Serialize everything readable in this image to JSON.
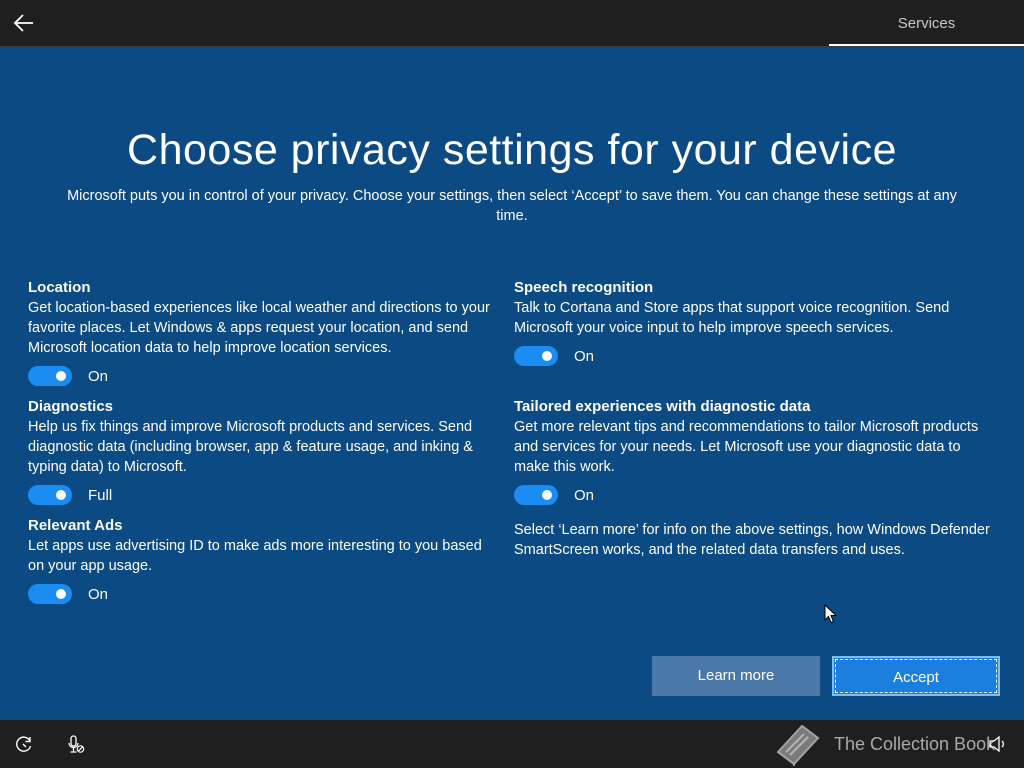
{
  "header": {
    "tab_label": "Services"
  },
  "page": {
    "title": "Choose privacy settings for your device",
    "description": "Microsoft puts you in control of your privacy. Choose your settings, then select ‘Accept’ to save them. You can change these settings at any time."
  },
  "settings": {
    "location": {
      "title": "Location",
      "description": "Get location-based experiences like local weather and directions to your favorite places. Let Windows & apps request your location, and send Microsoft location data to help improve location services.",
      "state": "On"
    },
    "diagnostics": {
      "title": "Diagnostics",
      "description": "Help us fix things and improve Microsoft products and services. Send diagnostic data (including browser, app & feature usage, and inking & typing data) to Microsoft.",
      "state": "Full"
    },
    "relevant_ads": {
      "title": "Relevant Ads",
      "description": "Let apps use advertising ID to make ads more interesting to you based on your app usage.",
      "state": "On"
    },
    "speech": {
      "title": "Speech recognition",
      "description": "Talk to Cortana and Store apps that support voice recognition. Send Microsoft your voice input to help improve speech services.",
      "state": "On"
    },
    "tailored": {
      "title": "Tailored experiences with diagnostic data",
      "description": "Get more relevant tips and recommendations to tailor Microsoft products and services for your needs. Let Microsoft use your diagnostic data to make this work.",
      "state": "On"
    }
  },
  "learn_more_info": "Select ‘Learn more’ for info on the above settings, how Windows Defender SmartScreen works, and the related data transfers and uses.",
  "buttons": {
    "learn_more": "Learn more",
    "accept": "Accept"
  },
  "footer": {
    "watermark": "The Collection Book"
  },
  "colors": {
    "background": "#0b4a82",
    "toggle_on": "#1b8cf2",
    "accept_button": "#1b7fe0",
    "learn_more_button": "#4a78a8",
    "bars": "#1f1f1f"
  }
}
